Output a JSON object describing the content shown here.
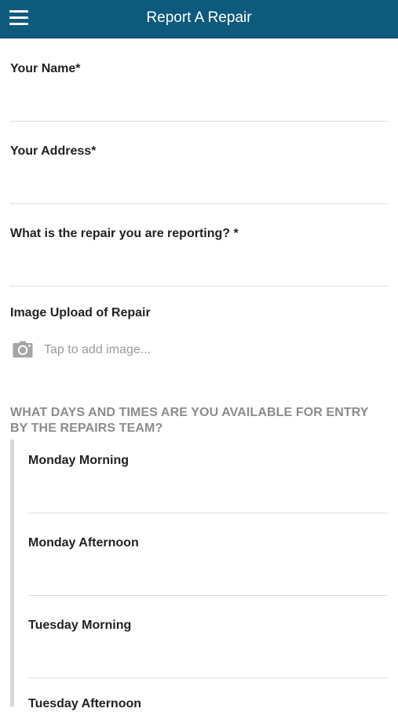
{
  "header": {
    "title": "Report A Repair",
    "menu_icon": "hamburger-menu-icon",
    "background_color": "#0d5a7c"
  },
  "form": {
    "name_label": "Your Name*",
    "address_label": "Your Address*",
    "repair_label": "What is the repair you are reporting? *",
    "image_label": "Image Upload of Repair",
    "image_placeholder": "Tap to add image...",
    "camera_icon": "camera-icon"
  },
  "availability": {
    "heading": "WHAT DAYS AND TIMES ARE YOU AVAILABLE FOR ENTRY BY THE REPAIRS TEAM?",
    "options": [
      {
        "label": "Monday Morning"
      },
      {
        "label": "Monday Afternoon"
      },
      {
        "label": "Tuesday Morning"
      },
      {
        "label": "Tuesday Afternoon"
      }
    ]
  }
}
